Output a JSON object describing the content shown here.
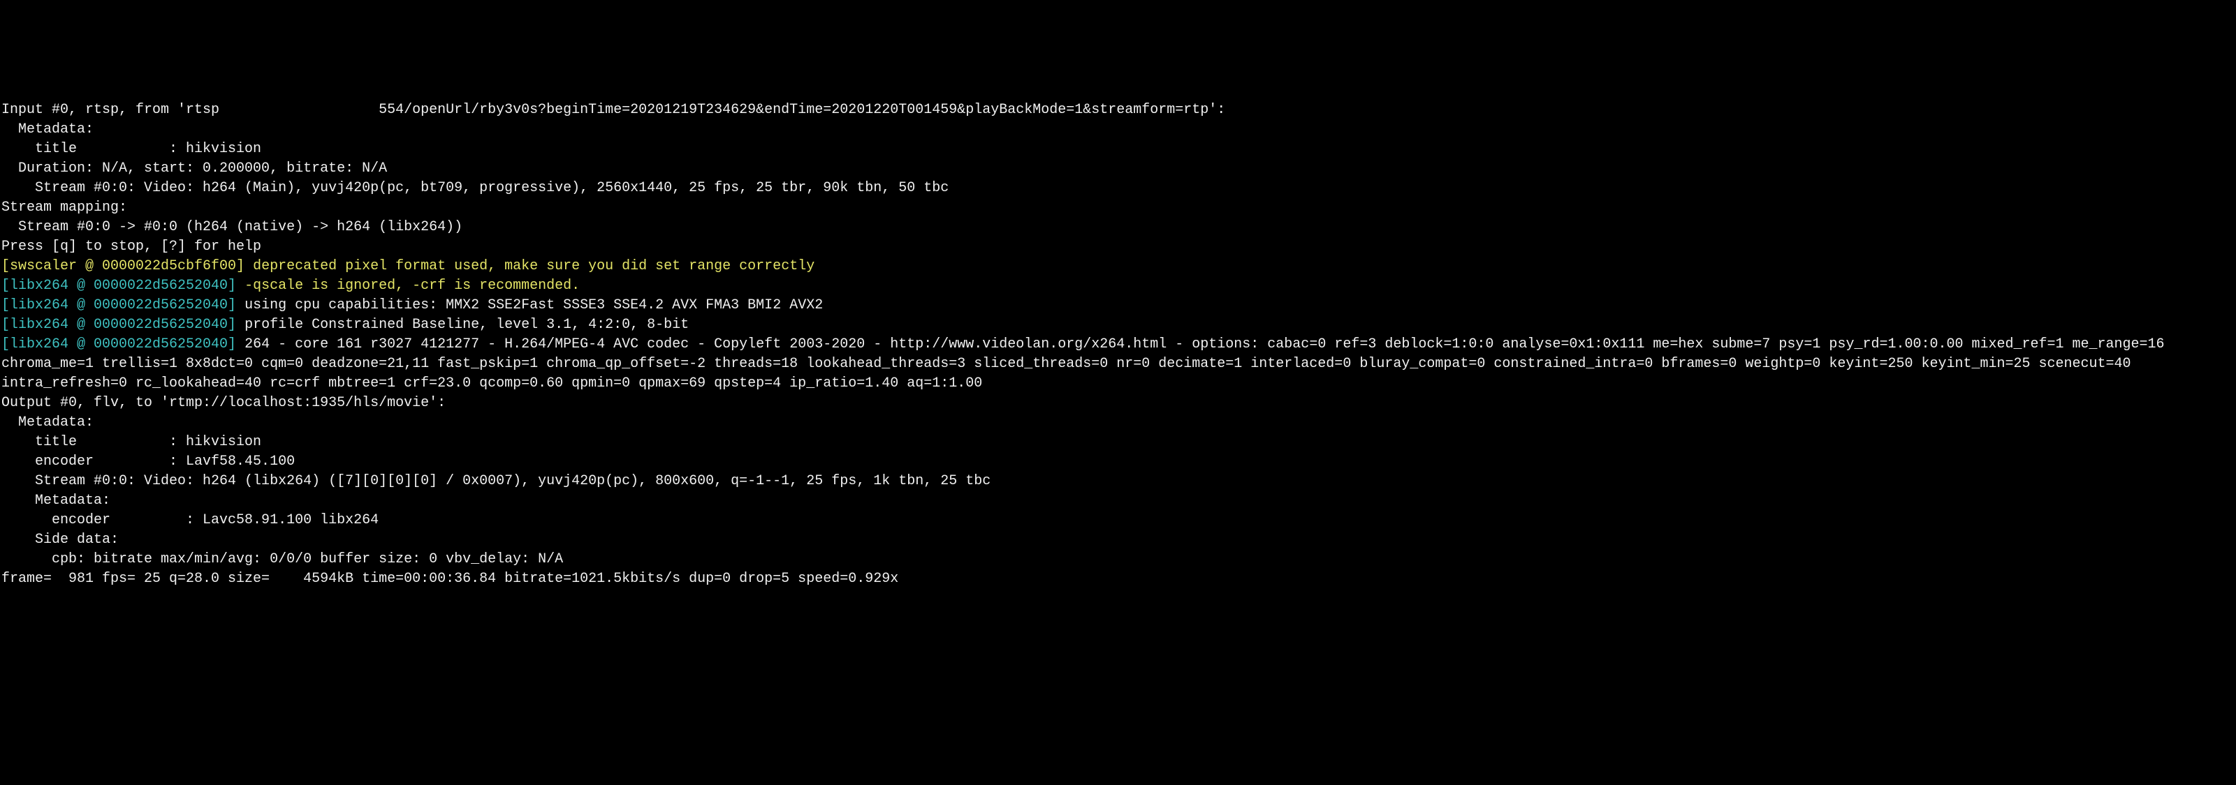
{
  "lines": {
    "l01": "Input #0, rtsp, from 'rtsp                   554/openUrl/rby3v0s?beginTime=20201219T234629&endTime=20201220T001459&playBackMode=1&streamform=rtp':",
    "l02": "  Metadata:",
    "l03": "    title           : hikvision",
    "l04": "  Duration: N/A, start: 0.200000, bitrate: N/A",
    "l05": "    Stream #0:0: Video: h264 (Main), yuvj420p(pc, bt709, progressive), 2560x1440, 25 fps, 25 tbr, 90k tbn, 50 tbc",
    "l06": "Stream mapping:",
    "l07": "  Stream #0:0 -> #0:0 (h264 (native) -> h264 (libx264))",
    "l08": "Press [q] to stop, [?] for help",
    "l09_tag": "[swscaler @ 0000022d5cbf6f00]",
    "l09_msg": " deprecated pixel format used, make sure you did set range correctly",
    "l10_tag": "[libx264 @ 0000022d56252040]",
    "l10_msg": " -qscale is ignored, -crf is recommended.",
    "l11_tag": "[libx264 @ 0000022d56252040]",
    "l11_msg": " using cpu capabilities: MMX2 SSE2Fast SSSE3 SSE4.2 AVX FMA3 BMI2 AVX2",
    "l12_tag": "[libx264 @ 0000022d56252040]",
    "l12_msg": " profile Constrained Baseline, level 3.1, 4:2:0, 8-bit",
    "l13_tag": "[libx264 @ 0000022d56252040]",
    "l13_msg": " 264 - core 161 r3027 4121277 - H.264/MPEG-4 AVC codec - Copyleft 2003-2020 - http://www.videolan.org/x264.html - options: cabac=0 ref=3 deblock=1:0:0 analyse=0x1:0x111 me=hex subme=7 psy=1 psy_rd=1.00:0.00 mixed_ref=1 me_range=16 chroma_me=1 trellis=1 8x8dct=0 cqm=0 deadzone=21,11 fast_pskip=1 chroma_qp_offset=-2 threads=18 lookahead_threads=3 sliced_threads=0 nr=0 decimate=1 interlaced=0 bluray_compat=0 constrained_intra=0 bframes=0 weightp=0 keyint=250 keyint_min=25 scenecut=40 intra_refresh=0 rc_lookahead=40 rc=crf mbtree=1 crf=23.0 qcomp=0.60 qpmin=0 qpmax=69 qpstep=4 ip_ratio=1.40 aq=1:1.00",
    "l14": "Output #0, flv, to 'rtmp://localhost:1935/hls/movie':",
    "l15": "  Metadata:",
    "l16": "    title           : hikvision",
    "l17": "    encoder         : Lavf58.45.100",
    "l18": "    Stream #0:0: Video: h264 (libx264) ([7][0][0][0] / 0x0007), yuvj420p(pc), 800x600, q=-1--1, 25 fps, 1k tbn, 25 tbc",
    "l19": "    Metadata:",
    "l20": "      encoder         : Lavc58.91.100 libx264",
    "l21": "    Side data:",
    "l22": "      cpb: bitrate max/min/avg: 0/0/0 buffer size: 0 vbv_delay: N/A",
    "l23": "frame=  981 fps= 25 q=28.0 size=    4594kB time=00:00:36.84 bitrate=1021.5kbits/s dup=0 drop=5 speed=0.929x"
  }
}
